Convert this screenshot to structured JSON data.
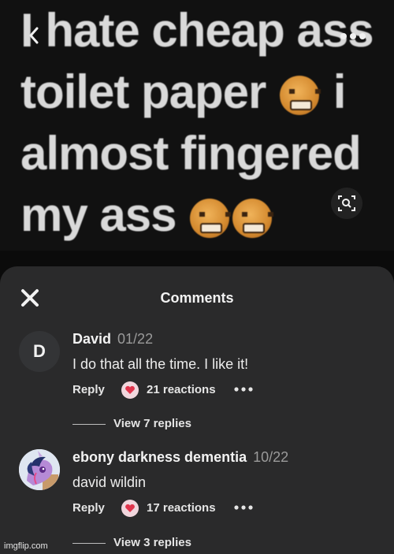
{
  "meme": {
    "line1": "I hate cheap ass",
    "line2": "toilet paper",
    "line2_suffix": "i",
    "line3": "almost fingered",
    "line4": "my ass",
    "emoji": "angry-face-emoji"
  },
  "icons": {
    "back": "chevron-left-icon",
    "more": "more-dots-icon",
    "lens": "visual-search-icon",
    "close": "close-icon",
    "reaction": "heart-reaction-icon"
  },
  "sheet": {
    "title": "Comments"
  },
  "comments": [
    {
      "avatar_letter": "D",
      "author": "David",
      "date": "01/22",
      "text": "I do that all the time. I like it!",
      "reply_label": "Reply",
      "reactions": "21 reactions",
      "view_replies": "View 7 replies"
    },
    {
      "author": "ebony darkness dementia",
      "date": "10/22",
      "text": "david wildin",
      "reply_label": "Reply",
      "reactions": "17 reactions",
      "view_replies": "View 3 replies"
    }
  ],
  "watermark": "imgflip.com",
  "colors": {
    "sheet_bg": "#2a2a2b",
    "reaction_heart": "#e0344c"
  }
}
